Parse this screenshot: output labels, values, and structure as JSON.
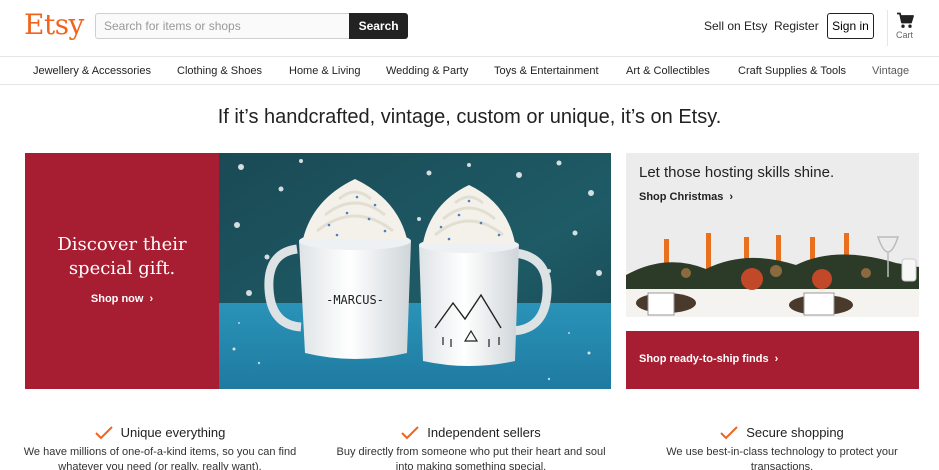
{
  "header": {
    "logo": "Etsy",
    "search_placeholder": "Search for items or shops",
    "search_button": "Search",
    "sell_link": "Sell on Etsy",
    "register_link": "Register",
    "signin_button": "Sign in",
    "cart_label": "Cart"
  },
  "categories": [
    "Jewellery & Accessories",
    "Clothing & Shoes",
    "Home & Living",
    "Wedding & Party",
    "Toys & Entertainment",
    "Art & Collectibles",
    "Craft Supplies & Tools",
    "Vintage"
  ],
  "headline": "If it’s handcrafted, vintage, custom or unique, it’s on Etsy.",
  "hero": {
    "title_line1": "Discover their",
    "title_line2": "special gift.",
    "link": "Shop now",
    "mug_text": "-MARCUS-"
  },
  "cards": {
    "top_title": "Let those hosting skills shine.",
    "top_link": "Shop Christmas",
    "bottom_link": "Shop ready-to-ship finds"
  },
  "value_props": [
    {
      "title": "Unique everything",
      "text": "We have millions of one-of-a-kind items, so you can find whatever you need (or really, really want)."
    },
    {
      "title": "Independent sellers",
      "text": "Buy directly from someone who put their heart and soul into making something special."
    },
    {
      "title": "Secure shopping",
      "text": "We use best-in-class technology to protect your transactions."
    }
  ],
  "colors": {
    "brand": "#f1641e",
    "hero_red": "#a71d31"
  }
}
